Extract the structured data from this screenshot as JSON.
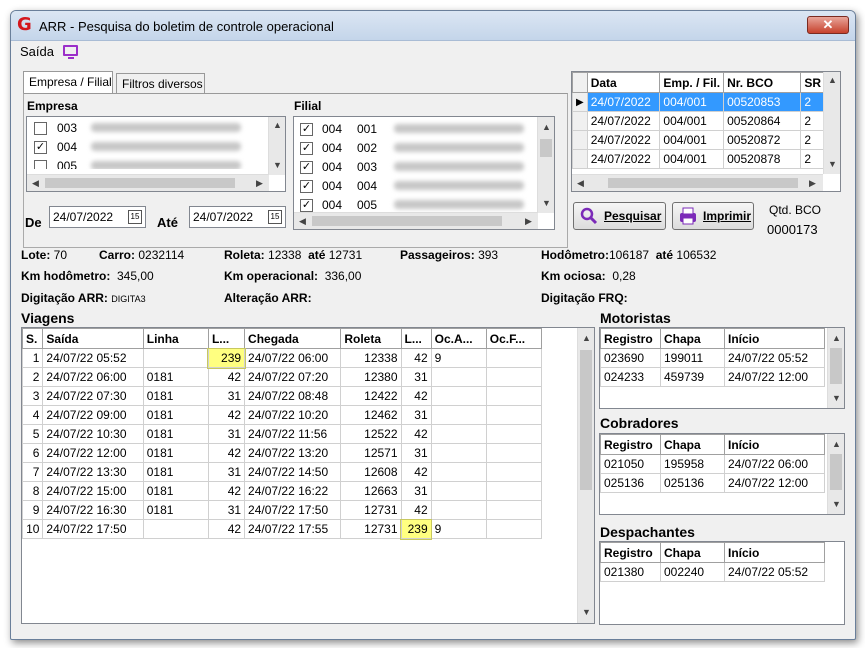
{
  "window": {
    "title": "ARR - Pesquisa do boletim de controle operacional",
    "close": "✕"
  },
  "menu": {
    "saida": "Saída"
  },
  "tabs": {
    "empresa_filial": "Empresa / Filial",
    "filtros": "Filtros diversos"
  },
  "empresa": {
    "label": "Empresa",
    "items": [
      {
        "code": "003",
        "checked": false
      },
      {
        "code": "004",
        "checked": true
      },
      {
        "code": "005",
        "checked": false
      }
    ]
  },
  "filial": {
    "label": "Filial",
    "items": [
      {
        "emp": "004",
        "fil": "001",
        "checked": true
      },
      {
        "emp": "004",
        "fil": "002",
        "checked": true
      },
      {
        "emp": "004",
        "fil": "003",
        "checked": true
      },
      {
        "emp": "004",
        "fil": "004",
        "checked": true
      },
      {
        "emp": "004",
        "fil": "005",
        "checked": true
      }
    ]
  },
  "dates": {
    "de_label": "De",
    "de": "24/07/2022",
    "ate_label": "Até",
    "ate": "24/07/2022"
  },
  "bco_grid": {
    "headers": [
      "Data",
      "Emp. / Fil.",
      "Nr. BCO",
      "SR"
    ],
    "rows": [
      [
        "24/07/2022",
        "004/001",
        "00520853",
        "2"
      ],
      [
        "24/07/2022",
        "004/001",
        "00520864",
        "2"
      ],
      [
        "24/07/2022",
        "004/001",
        "00520872",
        "2"
      ],
      [
        "24/07/2022",
        "004/001",
        "00520878",
        "2"
      ]
    ]
  },
  "buttons": {
    "pesquisar": "Pesquisar",
    "imprimir": "Imprimir"
  },
  "qtd": {
    "label": "Qtd. BCO",
    "value": "0000173"
  },
  "info": {
    "lote_label": "Lote:",
    "lote": "70",
    "carro_label": "Carro:",
    "carro": "0232114",
    "roleta_label": "Roleta:",
    "roleta_de": "12338",
    "ate_label": "até",
    "roleta_ate": "12731",
    "passageiros_label": "Passageiros:",
    "passageiros": "393",
    "hodometro_label": "Hodômetro:",
    "hodometro_de": "106187",
    "hodometro_ate": "106532",
    "kmhod_label": "Km hodômetro:",
    "kmhod": "345,00",
    "kmop_label": "Km operacional:",
    "kmop": "336,00",
    "kmoc_label": "Km ociosa:",
    "kmoc": "0,28",
    "dig_arr_label": "Digitação ARR:",
    "dig_arr": "DIGITA3",
    "alt_arr_label": "Alteração ARR:",
    "dig_frq_label": "Digitação FRQ:"
  },
  "viagens": {
    "title": "Viagens",
    "headers": [
      "S.",
      "Saída",
      "Linha",
      "L...",
      "Chegada",
      "Roleta",
      "L...",
      "Oc.A...",
      "Oc.F..."
    ],
    "rows": [
      [
        "1",
        "24/07/22 05:52",
        "",
        "239",
        "24/07/22 06:00",
        "12338",
        "42",
        "9",
        ""
      ],
      [
        "2",
        "24/07/22 06:00",
        "0181",
        "42",
        "24/07/22 07:20",
        "12380",
        "31",
        "",
        ""
      ],
      [
        "3",
        "24/07/22 07:30",
        "0181",
        "31",
        "24/07/22 08:48",
        "12422",
        "42",
        "",
        ""
      ],
      [
        "4",
        "24/07/22 09:00",
        "0181",
        "42",
        "24/07/22 10:20",
        "12462",
        "31",
        "",
        ""
      ],
      [
        "5",
        "24/07/22 10:30",
        "0181",
        "31",
        "24/07/22 11:56",
        "12522",
        "42",
        "",
        ""
      ],
      [
        "6",
        "24/07/22 12:00",
        "0181",
        "42",
        "24/07/22 13:20",
        "12571",
        "31",
        "",
        ""
      ],
      [
        "7",
        "24/07/22 13:30",
        "0181",
        "31",
        "24/07/22 14:50",
        "12608",
        "42",
        "",
        ""
      ],
      [
        "8",
        "24/07/22 15:00",
        "0181",
        "42",
        "24/07/22 16:22",
        "12663",
        "31",
        "",
        ""
      ],
      [
        "9",
        "24/07/22 16:30",
        "0181",
        "31",
        "24/07/22 17:50",
        "12731",
        "42",
        "",
        ""
      ],
      [
        "10",
        "24/07/22 17:50",
        "",
        "42",
        "24/07/22 17:55",
        "12731",
        "239",
        "9",
        ""
      ]
    ]
  },
  "motoristas": {
    "title": "Motoristas",
    "headers": [
      "Registro",
      "Chapa",
      "Início"
    ],
    "rows": [
      [
        "023690",
        "199011",
        "24/07/22 05:52"
      ],
      [
        "024233",
        "459739",
        "24/07/22 12:00"
      ]
    ]
  },
  "cobradores": {
    "title": "Cobradores",
    "headers": [
      "Registro",
      "Chapa",
      "Início"
    ],
    "rows": [
      [
        "021050",
        "195958",
        "24/07/22 06:00"
      ],
      [
        "025136",
        "025136",
        "24/07/22 12:00"
      ]
    ]
  },
  "despachantes": {
    "title": "Despachantes",
    "headers": [
      "Registro",
      "Chapa",
      "Início"
    ],
    "rows": [
      [
        "021380",
        "002240",
        "24/07/22 05:52"
      ]
    ]
  },
  "colors": {
    "highlight": "#ffff80",
    "selection": "#3399ff",
    "brand": "#d4171c"
  }
}
